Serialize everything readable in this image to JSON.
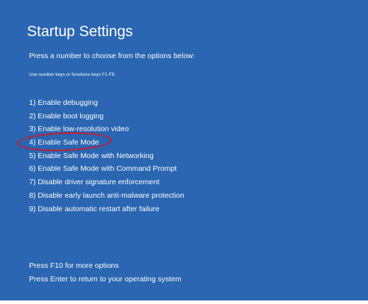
{
  "screen": {
    "title": "Startup Settings",
    "subtitle": "Press a number to choose from the options below:",
    "hint": "Use number keys or functions keys F1-F9."
  },
  "options": [
    "1) Enable debugging",
    "2) Enable boot logging",
    "3) Enable low-resolution video",
    "4) Enable Safe Mode",
    "5) Enable Safe Mode with Networking",
    "6) Enable Safe Mode with Command Prompt",
    "7) Disable driver signature enforcement",
    "8) Disable early launch anti-malware protection",
    "9) Disable automatic restart after failure"
  ],
  "footer": {
    "more_options": "Press F10 for more options",
    "return": "Press Enter to return to your operating system"
  },
  "colors": {
    "background": "#2a66b1",
    "text": "#ffffff",
    "highlight": "#cc1b2b"
  },
  "highlighted_option_index": 3
}
